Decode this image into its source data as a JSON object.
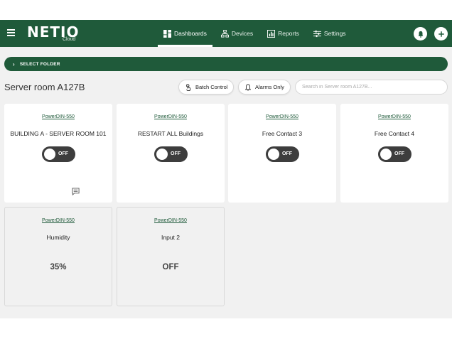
{
  "app": {
    "logo": "NETIO",
    "logo_sub": "Cloud"
  },
  "nav": [
    {
      "label": "Dashboards",
      "icon": "dashboard-grid-icon",
      "active": true
    },
    {
      "label": "Devices",
      "icon": "device-tree-icon",
      "active": false
    },
    {
      "label": "Reports",
      "icon": "chart-icon",
      "active": false
    },
    {
      "label": "Settings",
      "icon": "sliders-icon",
      "active": false
    }
  ],
  "header_actions": {
    "notifications_icon": "bell-icon",
    "add_icon": "plus-icon"
  },
  "folder": {
    "label": "SELECT FOLDER"
  },
  "toolbar": {
    "title": "Server room A127B",
    "batch_label": "Batch Control",
    "alarms_label": "Alarms Only",
    "search_placeholder": "Search in Server room A127B..."
  },
  "cards": [
    {
      "device": "PowerDIN-550",
      "name": "BUILDING A - SERVER ROOM 101",
      "type": "switch",
      "state": "OFF"
    },
    {
      "device": "PowerDIN-550",
      "name": "RESTART ALL Buildings",
      "type": "switch",
      "state": "OFF"
    },
    {
      "device": "PowerDIN-550",
      "name": "Free Contact 3",
      "type": "switch",
      "state": "OFF"
    },
    {
      "device": "PowerDIN-550",
      "name": "Free Contact 4",
      "type": "switch",
      "state": "OFF"
    },
    {
      "device": "PowerDIN-550",
      "name": "Humidity",
      "type": "sensor",
      "value": "35%"
    },
    {
      "device": "PowerDIN-550",
      "name": "Input 2",
      "type": "sensor",
      "value": "OFF"
    }
  ],
  "colors": {
    "brand": "#1f5a3a",
    "toggle_off": "#3d3d3d",
    "background": "#f1f1f1"
  }
}
